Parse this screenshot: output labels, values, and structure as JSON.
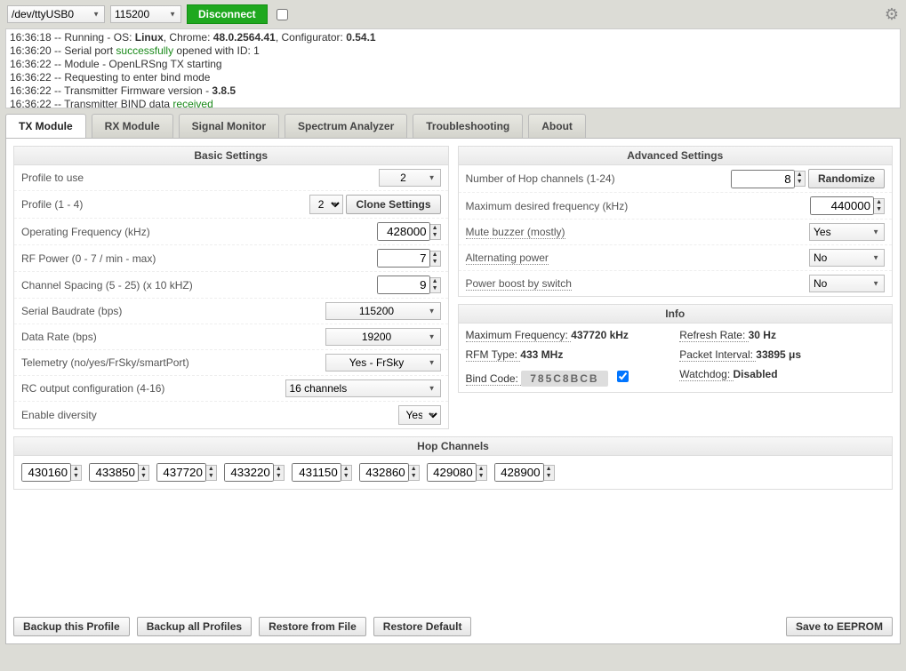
{
  "toolbar": {
    "port": "/dev/ttyUSB0",
    "baud": "115200",
    "disconnect": "Disconnect"
  },
  "log": [
    {
      "t": "16:36:18",
      "plain": " -- Running - OS: ",
      "b1": "Linux",
      "plain2": ", Chrome: ",
      "b2": "48.0.2564.41",
      "plain3": ", Configurator: ",
      "b3": "0.54.1"
    },
    {
      "t": "16:36:20",
      "plain": " -- Serial port ",
      "g": "successfully",
      "plain2": " opened with ID: 1"
    },
    {
      "t": "16:36:22",
      "plain": " -- Module - OpenLRSng TX starting"
    },
    {
      "t": "16:36:22",
      "plain": " -- Requesting to enter bind mode"
    },
    {
      "t": "16:36:22",
      "plain": " -- Transmitter Firmware version - ",
      "b1": "3.8.5"
    },
    {
      "t": "16:36:22",
      "plain": " -- Transmitter BIND data ",
      "g": "received"
    }
  ],
  "tabs": [
    "TX Module",
    "RX Module",
    "Signal Monitor",
    "Spectrum Analyzer",
    "Troubleshooting",
    "About"
  ],
  "basic": {
    "title": "Basic Settings",
    "profile_use_label": "Profile to use",
    "profile_use": "2",
    "profile_14_label": "Profile (1 - 4)",
    "profile_14": "2",
    "clone_btn": "Clone Settings",
    "opfreq_label": "Operating Frequency (kHz)",
    "opfreq": "428000",
    "rfpower_label": "RF Power (0 - 7 / min - max)",
    "rfpower": "7",
    "chspacing_label": "Channel Spacing (5 - 25) (x 10 kHZ)",
    "chspacing": "9",
    "baud_label": "Serial Baudrate (bps)",
    "baud": "115200",
    "datarate_label": "Data Rate (bps)",
    "datarate": "19200",
    "telemetry_label": "Telemetry (no/yes/FrSky/smartPort)",
    "telemetry": "Yes - FrSky",
    "rcout_label": "RC output configuration (4-16)",
    "rcout": "16 channels",
    "diversity_label": "Enable diversity",
    "diversity": "Yes"
  },
  "advanced": {
    "title": "Advanced Settings",
    "hopch_label": "Number of Hop channels (1-24)",
    "hopch": "8",
    "randomize": "Randomize",
    "maxfreq_label": "Maximum desired frequency (kHz)",
    "maxfreq": "440000",
    "mute_label": "Mute buzzer (mostly)",
    "mute": "Yes",
    "altpower_label": "Alternating power",
    "altpower": "No",
    "boost_label": "Power boost by switch",
    "boost": "No"
  },
  "info": {
    "title": "Info",
    "maxfreq_label": "Maximum Frequency: ",
    "maxfreq": "437720 kHz",
    "refresh_label": "Refresh Rate: ",
    "refresh": "30 Hz",
    "rfm_label": "RFM Type: ",
    "rfm": "433 MHz",
    "pkt_label": "Packet Interval: ",
    "pkt": "33895 μs",
    "bind_label": "Bind Code: ",
    "bind": "785C8BCB",
    "wd_label": "Watchdog: ",
    "wd": "Disabled"
  },
  "hop": {
    "title": "Hop Channels",
    "values": [
      "430160",
      "433850",
      "437720",
      "433220",
      "431150",
      "432860",
      "429080",
      "428900"
    ]
  },
  "bottom": {
    "backup_profile": "Backup this Profile",
    "backup_all": "Backup all Profiles",
    "restore_file": "Restore from File",
    "restore_default": "Restore Default",
    "save": "Save to EEPROM"
  }
}
